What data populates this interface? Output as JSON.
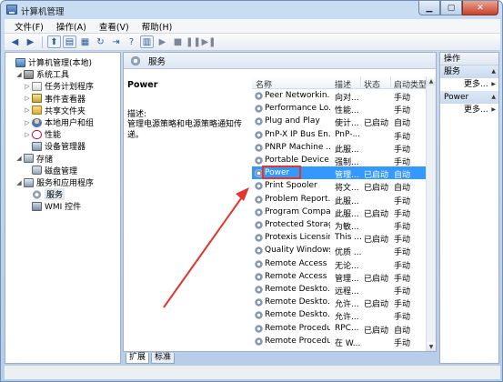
{
  "window": {
    "title": "计算机管理"
  },
  "menu": [
    "文件(F)",
    "操作(A)",
    "查看(V)",
    "帮助(H)"
  ],
  "tree": [
    {
      "label": "计算机管理(本地)",
      "indent": 0,
      "expander": "",
      "icon": "computer-icon",
      "cls": "ic-pc"
    },
    {
      "label": "系统工具",
      "indent": 1,
      "expander": "◢",
      "icon": "tools-icon",
      "cls": "ic-tools"
    },
    {
      "label": "任务计划程序",
      "indent": 2,
      "expander": "▷",
      "icon": "task-scheduler-icon",
      "cls": "ic-task"
    },
    {
      "label": "事件查看器",
      "indent": 2,
      "expander": "▷",
      "icon": "event-viewer-icon",
      "cls": "ic-event"
    },
    {
      "label": "共享文件夹",
      "indent": 2,
      "expander": "▷",
      "icon": "shared-folder-icon",
      "cls": "ic-folder"
    },
    {
      "label": "本地用户和组",
      "indent": 2,
      "expander": "▷",
      "icon": "users-icon",
      "cls": "ic-users"
    },
    {
      "label": "性能",
      "indent": 2,
      "expander": "▷",
      "icon": "performance-icon",
      "cls": "ic-perf"
    },
    {
      "label": "设备管理器",
      "indent": 2,
      "expander": "",
      "icon": "device-manager-icon",
      "cls": "ic-dev"
    },
    {
      "label": "存储",
      "indent": 1,
      "expander": "◢",
      "icon": "storage-icon",
      "cls": "ic-store"
    },
    {
      "label": "磁盘管理",
      "indent": 2,
      "expander": "",
      "icon": "disk-icon",
      "cls": "ic-disk"
    },
    {
      "label": "服务和应用程序",
      "indent": 1,
      "expander": "◢",
      "icon": "services-apps-icon",
      "cls": "ic-svcapp"
    },
    {
      "label": "服务",
      "indent": 2,
      "expander": "",
      "icon": "services-gear-icon",
      "cls": "ic-gear"
    },
    {
      "label": "WMI 控件",
      "indent": 2,
      "expander": "",
      "icon": "wmi-icon",
      "cls": "ic-wmi"
    }
  ],
  "middle": {
    "header": "服务",
    "selected_name": "Power",
    "desc_label": "描述:",
    "desc_text": "管理电源策略和电源策略通知传递。",
    "columns": [
      "名称",
      "描述",
      "状态",
      "启动类型"
    ],
    "rows": [
      {
        "name": "Peer Networkin...",
        "desc": "向对...",
        "status": "",
        "startup": "手动"
      },
      {
        "name": "Performance Lo...",
        "desc": "性能...",
        "status": "",
        "startup": "手动"
      },
      {
        "name": "Plug and Play",
        "desc": "使计...",
        "status": "已启动",
        "startup": "自动"
      },
      {
        "name": "PnP-X IP Bus En...",
        "desc": "PnP-...",
        "status": "",
        "startup": "手动"
      },
      {
        "name": "PNRP Machine ...",
        "desc": "此服...",
        "status": "",
        "startup": "手动"
      },
      {
        "name": "Portable Device ...",
        "desc": "强制...",
        "status": "",
        "startup": "手动"
      },
      {
        "name": "Power",
        "desc": "管理...",
        "status": "已启动",
        "startup": "自动"
      },
      {
        "name": "Print Spooler",
        "desc": "将文...",
        "status": "已启动",
        "startup": "自动"
      },
      {
        "name": "Problem Report...",
        "desc": "此服...",
        "status": "",
        "startup": "手动"
      },
      {
        "name": "Program Compa...",
        "desc": "此服...",
        "status": "已启动",
        "startup": "手动"
      },
      {
        "name": "Protected Storage",
        "desc": "为敏...",
        "status": "",
        "startup": "手动"
      },
      {
        "name": "Protexis Licensin...",
        "desc": "This ...",
        "status": "已启动",
        "startup": "手动"
      },
      {
        "name": "Quality Windows...",
        "desc": "优质 ...",
        "status": "",
        "startup": "手动"
      },
      {
        "name": "Remote Access ...",
        "desc": "无论...",
        "status": "",
        "startup": "手动"
      },
      {
        "name": "Remote Access ...",
        "desc": "管理...",
        "status": "已启动",
        "startup": "手动"
      },
      {
        "name": "Remote Deskto...",
        "desc": "远程...",
        "status": "",
        "startup": "手动"
      },
      {
        "name": "Remote Deskto...",
        "desc": "允许...",
        "status": "已启动",
        "startup": "手动"
      },
      {
        "name": "Remote Deskto...",
        "desc": "允许...",
        "status": "",
        "startup": "手动"
      },
      {
        "name": "Remote Procedu...",
        "desc": "RPC...",
        "status": "已启动",
        "startup": "自动"
      },
      {
        "name": "Remote Procedu...",
        "desc": "在 W...",
        "status": "",
        "startup": "手动"
      }
    ]
  },
  "tabs": [
    "扩展",
    "标准"
  ],
  "actions": {
    "title": "操作",
    "groups": [
      {
        "label": "服务",
        "more": "更多..."
      },
      {
        "label": "Power",
        "more": "更多..."
      }
    ]
  },
  "accent": {
    "selection": "#3399ff",
    "highlight_box": "#e0362d",
    "arrow": "#e0362d"
  }
}
